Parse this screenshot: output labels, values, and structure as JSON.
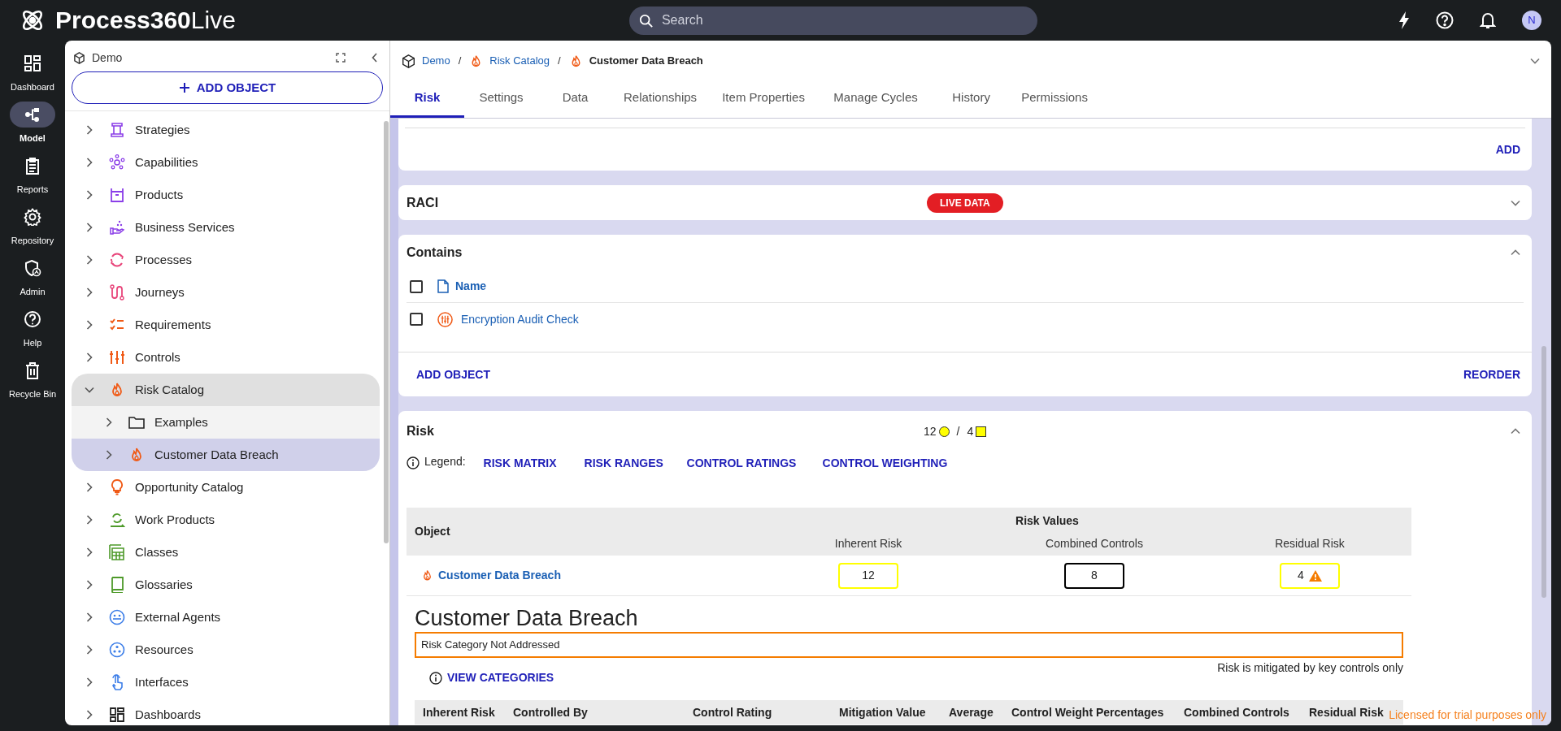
{
  "app": {
    "logo_bold": "Process360",
    "logo_light": "Live"
  },
  "search": {
    "placeholder": "Search"
  },
  "user": {
    "initial": "N"
  },
  "nav": [
    {
      "label": "Dashboard",
      "kind": "dashboard",
      "selected": false
    },
    {
      "label": "Model",
      "kind": "model",
      "selected": true
    },
    {
      "label": "Reports",
      "kind": "reports",
      "selected": false
    },
    {
      "label": "Repository",
      "kind": "repository",
      "selected": false
    },
    {
      "label": "Admin",
      "kind": "admin",
      "selected": false
    },
    {
      "label": "Help",
      "kind": "help",
      "selected": false
    },
    {
      "label": "Recycle Bin",
      "kind": "trash",
      "selected": false
    }
  ],
  "tree_panel": {
    "title": "Demo",
    "add_button": "ADD OBJECT"
  },
  "tree": [
    {
      "label": "Strategies",
      "kind": "strategy",
      "expanded": false,
      "selected": false
    },
    {
      "label": "Capabilities",
      "kind": "capability",
      "expanded": false,
      "selected": false
    },
    {
      "label": "Products",
      "kind": "product",
      "expanded": false,
      "selected": false
    },
    {
      "label": "Business Services",
      "kind": "service",
      "expanded": false,
      "selected": false
    },
    {
      "label": "Processes",
      "kind": "process",
      "expanded": false,
      "selected": false
    },
    {
      "label": "Journeys",
      "kind": "journey",
      "expanded": false,
      "selected": false
    },
    {
      "label": "Requirements",
      "kind": "requirement",
      "expanded": false,
      "selected": false
    },
    {
      "label": "Controls",
      "kind": "control",
      "expanded": false,
      "selected": false
    },
    {
      "label": "Risk Catalog",
      "kind": "risk",
      "expanded": true,
      "selected": false,
      "children": [
        {
          "label": "Examples",
          "kind": "folder",
          "expanded": false,
          "selected": false
        },
        {
          "label": "Customer Data Breach",
          "kind": "risk",
          "expanded": false,
          "selected": true
        }
      ]
    },
    {
      "label": "Opportunity Catalog",
      "kind": "opportunity",
      "expanded": false,
      "selected": false
    },
    {
      "label": "Work Products",
      "kind": "work_product",
      "expanded": false,
      "selected": false
    },
    {
      "label": "Classes",
      "kind": "class",
      "expanded": false,
      "selected": false
    },
    {
      "label": "Glossaries",
      "kind": "glossary",
      "expanded": false,
      "selected": false
    },
    {
      "label": "External Agents",
      "kind": "agent",
      "expanded": false,
      "selected": false
    },
    {
      "label": "Resources",
      "kind": "resource",
      "expanded": false,
      "selected": false
    },
    {
      "label": "Interfaces",
      "kind": "interface",
      "expanded": false,
      "selected": false
    },
    {
      "label": "Dashboards",
      "kind": "dashboard",
      "expanded": false,
      "selected": false
    }
  ],
  "breadcrumb": [
    {
      "label": "Demo",
      "kind": "model",
      "link": true
    },
    {
      "separator": "/",
      "label": "Risk Catalog",
      "kind": "risk",
      "link": true
    },
    {
      "separator": "/",
      "label": "Customer Data Breach",
      "kind": "risk",
      "link": false
    }
  ],
  "tabs": [
    {
      "label": "Risk",
      "selected": true
    },
    {
      "label": "Settings",
      "selected": false
    },
    {
      "label": "Data",
      "selected": false
    },
    {
      "label": "Relationships",
      "selected": false
    },
    {
      "label": "Item Properties",
      "selected": false
    },
    {
      "label": "Manage Cycles",
      "selected": false
    },
    {
      "label": "History",
      "selected": false
    },
    {
      "label": "Permissions",
      "selected": false
    }
  ],
  "top_card": {
    "action": "ADD"
  },
  "raci": {
    "title": "RACI",
    "badge": "LIVE DATA",
    "expanded": false
  },
  "contains": {
    "title": "Contains",
    "expanded": true,
    "header": "Name",
    "rows": [
      {
        "name": "Encryption Audit Check",
        "checked": false
      }
    ],
    "header_checked": false,
    "add_button": "ADD OBJECT",
    "reorder_button": "REORDER"
  },
  "risk": {
    "title": "Risk",
    "expanded": true,
    "summary": [
      {
        "value": "12",
        "kind": "circle",
        "color": "#ffff00"
      },
      {
        "value": "4",
        "kind": "square",
        "color": "#ffff00"
      }
    ],
    "summary_separator": "/",
    "legend_label": "Legend:",
    "legend_links": [
      "RISK MATRIX",
      "RISK RANGES",
      "CONTROL RATINGS",
      "CONTROL WEIGHTING"
    ],
    "table": {
      "object_header": "Object",
      "group_header": "Risk Values",
      "value_headers": [
        "Inherent Risk",
        "Combined Controls",
        "Residual Risk"
      ],
      "rows": [
        {
          "object": "Customer Data Breach",
          "values": [
            {
              "value": "12",
              "color": "#ffff00",
              "warning": false
            },
            {
              "value": "8",
              "color": "#000000",
              "warning": false
            },
            {
              "value": "4",
              "color": "#ffff00",
              "warning": true
            }
          ]
        }
      ]
    },
    "detail_title": "Customer Data Breach",
    "category_message": "Risk Category Not Addressed",
    "note": "Risk is mitigated by key controls only",
    "view_categories": "VIEW CATEGORIES",
    "detail_columns": [
      "Inherent Risk",
      "Controlled By",
      "Control Rating",
      "Mitigation Value",
      "Average",
      "Control Weight Percentages",
      "Combined Controls",
      "Residual Risk"
    ]
  },
  "license_notice": "Licensed for trial purposes only"
}
